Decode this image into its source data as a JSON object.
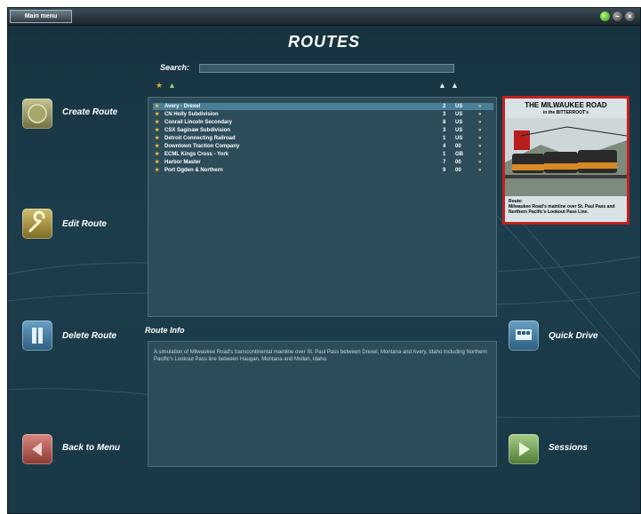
{
  "topbar": {
    "main_menu_label": "Main menu"
  },
  "title": "ROUTES",
  "search": {
    "label": "Search:",
    "value": ""
  },
  "routes": [
    {
      "name": "Avery - Drexel",
      "num": "2",
      "country": "US",
      "selected": true
    },
    {
      "name": "CN Holly Subdivision",
      "num": "3",
      "country": "US"
    },
    {
      "name": "Conrail Lincoln Secondary",
      "num": "8",
      "country": "US"
    },
    {
      "name": "CSX Saginaw Subdivision",
      "num": "3",
      "country": "US"
    },
    {
      "name": "Detroit Connecting Railroad",
      "num": "1",
      "country": "US"
    },
    {
      "name": "Downtown Traction Company",
      "num": "4",
      "country": "00"
    },
    {
      "name": "ECML Kings Cross - York",
      "num": "1",
      "country": "GB"
    },
    {
      "name": "Harbor Master",
      "num": "7",
      "country": "00"
    },
    {
      "name": "Port Ogden & Northern",
      "num": "9",
      "country": "00"
    }
  ],
  "row_arrow": "»",
  "preview": {
    "title": "THE MILWAUKEE ROAD",
    "subtitle": "in the BITTERROOT's",
    "caption_heading": "Route:",
    "caption": "Milwaukee Road's mainline over St. Paul Pass and Northern Pacific's Lookout Pass Line."
  },
  "buttons": {
    "create": "Create Route",
    "edit": "Edit Route",
    "delete": "Delete Route",
    "back": "Back to Menu",
    "quick_drive": "Quick Drive",
    "sessions": "Sessions"
  },
  "route_info": {
    "title": "Route Info",
    "text": "A simulation of Milwaukee Road's transcontinental mainline over St. Paul Pass between Drexel, Montana and Avery, Idaho including Northern Pacific's Lookout Pass line between Haugan, Montana and Mullan, Idaho."
  },
  "colors": {
    "accent_red": "#c42020",
    "selection": "#4b7f98",
    "panel": "#2d4c5a"
  }
}
